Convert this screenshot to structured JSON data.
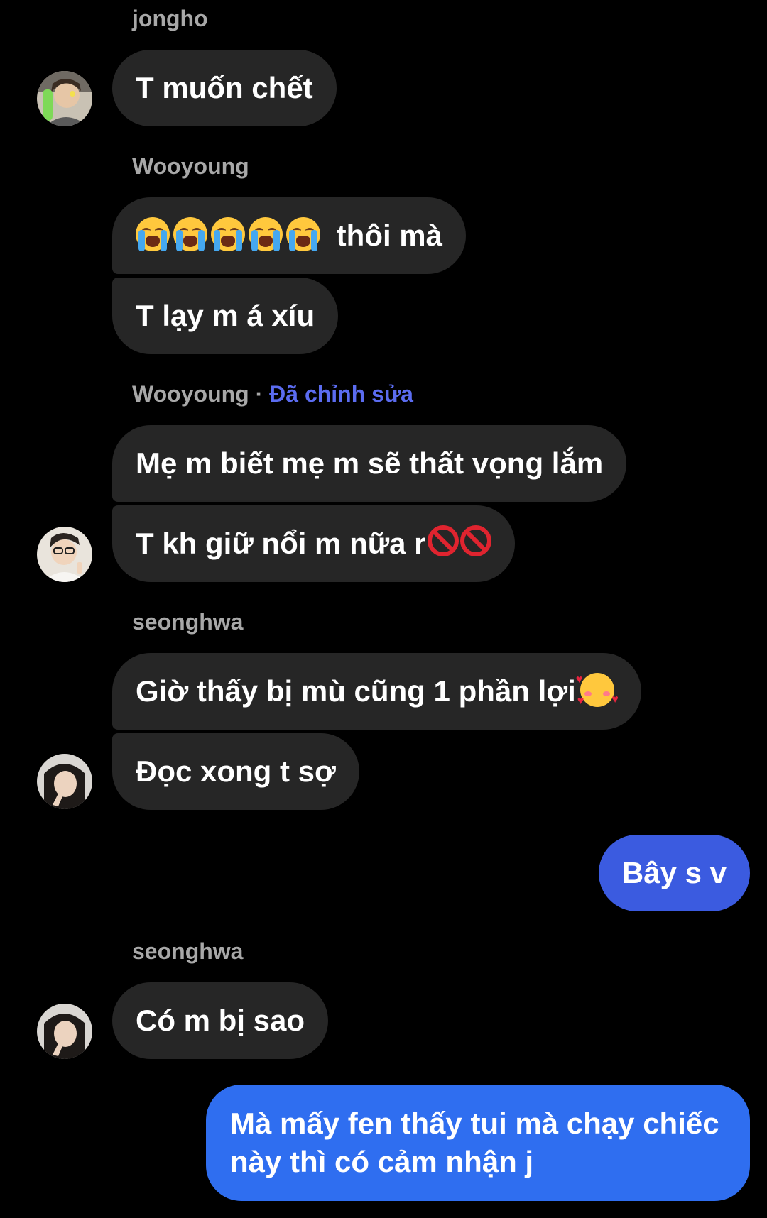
{
  "theme": {
    "background": "#000000",
    "bubble_incoming": "#262626",
    "bubble_outgoing": "#3b5be0",
    "bubble_outgoing_light": "#2f6ef0",
    "sender_name": "#a8a8a8",
    "edited_label": "#5b6cf0"
  },
  "groups": [
    {
      "sender": "jongho",
      "messages": [
        "T muốn chết"
      ]
    },
    {
      "sender": "Wooyoung",
      "messages": [
        "thôi mà",
        "T lạy m á xíu"
      ],
      "emoji_prefix": {
        "icon": "loudly-crying-face",
        "count": 5
      }
    },
    {
      "sender": "Wooyoung",
      "separator": " · ",
      "edited_label": "Đã chỉnh sửa",
      "messages": [
        "Mẹ m biết mẹ m sẽ thất vọng lắm",
        "T kh giữ nổi m nữa r"
      ],
      "emoji_suffix": {
        "icon": "prohibited-sign",
        "count": 2
      }
    },
    {
      "sender": "seonghwa",
      "messages": [
        "Giờ thấy bị mù cũng 1 phần lợi",
        "Đọc xong t sợ"
      ],
      "emoji_suffix": {
        "icon": "smiling-face-with-hearts",
        "count": 1
      }
    },
    {
      "outgoing": true,
      "messages": [
        "Bây s v"
      ]
    },
    {
      "sender": "seonghwa",
      "messages": [
        "Có m bị sao"
      ]
    },
    {
      "outgoing": true,
      "messages": [
        "Mà mấy fen thấy tui mà chạy chiếc này thì có cảm nhận j"
      ]
    }
  ]
}
